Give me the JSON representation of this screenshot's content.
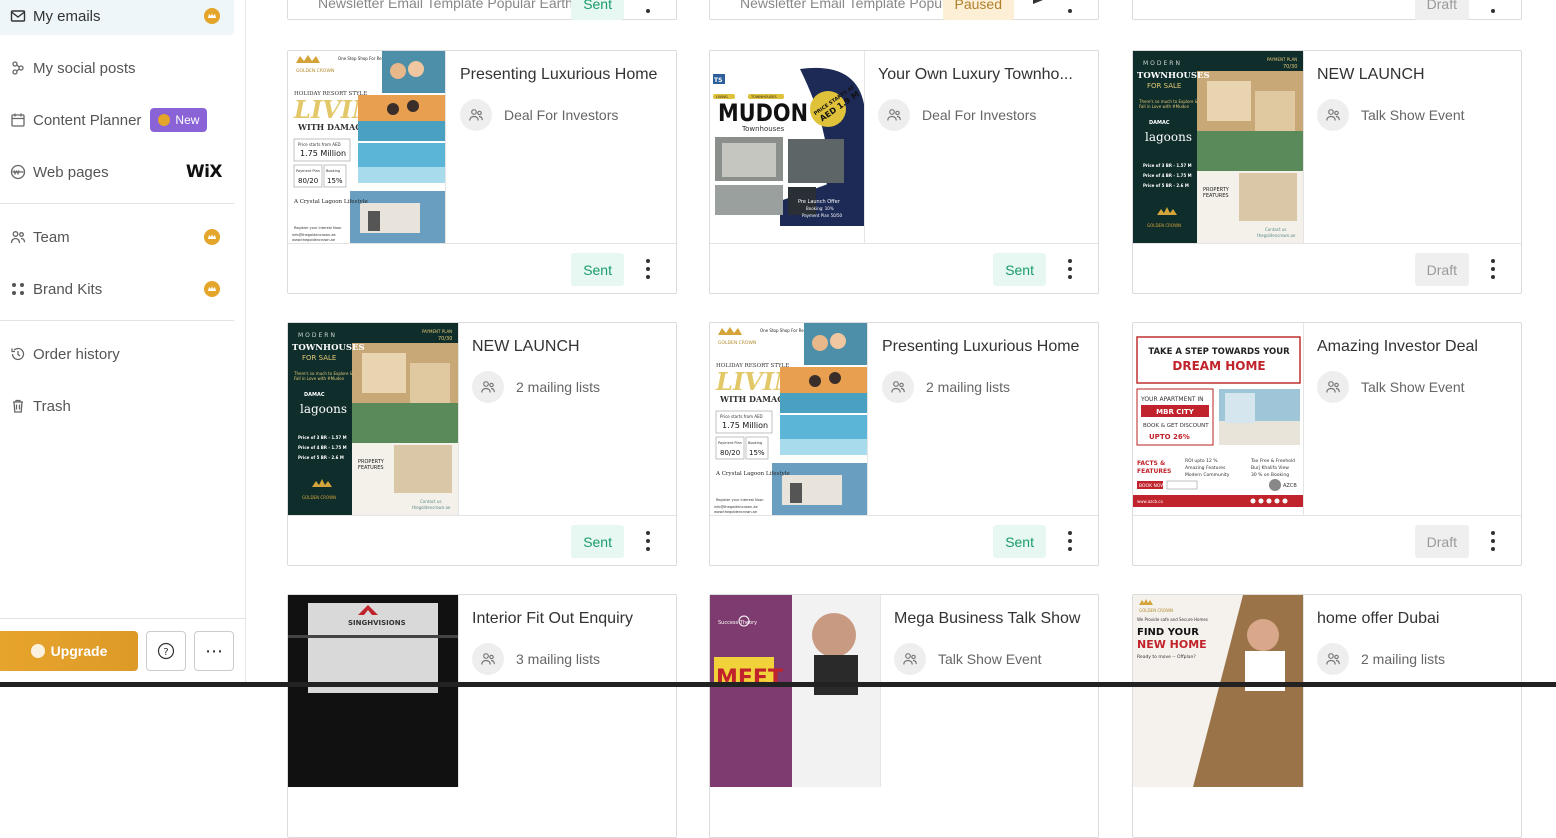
{
  "sidebar": {
    "items": [
      {
        "label": "My emails",
        "icon": "mail-icon",
        "crown": true,
        "active": true
      },
      {
        "label": "My social posts",
        "icon": "social-icon"
      },
      {
        "label": "Content Planner",
        "icon": "calendar-icon",
        "badge": "New"
      },
      {
        "label": "Web pages",
        "icon": "web-icon",
        "brand": "WiX"
      },
      {
        "label": "Team",
        "icon": "team-icon",
        "crown": true
      },
      {
        "label": "Brand Kits",
        "icon": "brand-kit-icon",
        "crown": true
      },
      {
        "label": "Order history",
        "icon": "history-icon"
      },
      {
        "label": "Trash",
        "icon": "trash-icon"
      }
    ],
    "upgrade_label": "Upgrade",
    "help_label": "?",
    "more_label": "⋯"
  },
  "top_partial": [
    {
      "text": "Newsletter Email Template Popular Earth",
      "status": "Sent"
    },
    {
      "text": "Newsletter Email Template Popular",
      "status": "Paused"
    },
    {
      "text": "",
      "status": "Draft"
    }
  ],
  "cards": [
    {
      "title": "Presenting Luxurious Home",
      "list": "Deal For Investors",
      "status": "Sent",
      "thumb": "golden",
      "thumb_text": {
        "brand": "GOLDEN CROWN",
        "tag": "One Stop Shop For Real Estate Solutions",
        "line1": "HOLIDAY RESORT STYLE",
        "line2": "LIVING",
        "line3": "WITH DAMAC",
        "price_lbl": "Price starts from AED",
        "price": "1.75 Million",
        "plan_lbl": "Payment Plan",
        "plan": "80/20",
        "booking_lbl": "Booking",
        "booking": "15%",
        "lagoon": "A Crystal Lagoon Lifestyle",
        "register": "Register your interest Now:",
        "email": "info@thegoldencrown.ae",
        "web": "www.thegoldencrown.ae"
      }
    },
    {
      "title": "Your Own Luxury  Townho...",
      "list": "Deal For Investors",
      "status": "Sent",
      "thumb": "mudon",
      "thumb_text": {
        "logo": "TS",
        "label1": "LIVING",
        "label2": "TOWNHOUSES",
        "name": "MUDON",
        "sub": "Townhouses",
        "badge": "PRICE STARTS AT AED 1.9 M",
        "offer": "Pre Launch Offer",
        "booking": "Booking: 10%",
        "plan": "Payment Plan 50/50"
      }
    },
    {
      "title": "NEW LAUNCH",
      "list": "Talk Show Event",
      "status": "Draft",
      "thumb": "townhouse",
      "thumb_text": {
        "line1": "MODERN",
        "line2": "TOWNHOUSES",
        "line3": "FOR SALE",
        "plan": "PAYMENT PLAN 70/30",
        "tag": "There's so much to Explore & Fall in Love with #Mudon",
        "brand": "DAMAC",
        "brand2": "lagoons",
        "prices": [
          "Price of 3 BR - 1.57 M",
          "Price of 4 BR - 1.75 M",
          "Price of 5 BR - 2.6 M"
        ],
        "feat": "PROPERTY FEATURES",
        "logo": "GOLDEN CROWN",
        "contact": "Contact us thegoldencrown.ae"
      }
    },
    {
      "title": "NEW LAUNCH",
      "list": "2 mailing lists",
      "status": "Sent",
      "thumb": "townhouse",
      "thumb_text": {
        "line1": "MODERN",
        "line2": "TOWNHOUSES",
        "line3": "FOR SALE",
        "plan": "PAYMENT PLAN 70/30",
        "tag": "There's so much to Explore & Fall in Love with #Mudon",
        "brand": "DAMAC",
        "brand2": "lagoons",
        "prices": [
          "Price of 3 BR - 1.57 M",
          "Price of 4 BR - 1.75 M",
          "Price of 5 BR - 2.6 M"
        ],
        "feat": "PROPERTY FEATURES",
        "logo": "GOLDEN CROWN",
        "contact": "Contact us thegoldencrown.ae"
      }
    },
    {
      "title": "Presenting Luxurious Home",
      "list": "2 mailing lists",
      "status": "Sent",
      "thumb": "golden",
      "thumb_text": {
        "brand": "GOLDEN CROWN",
        "tag": "One Stop Shop For Real Estate Solutions",
        "line1": "HOLIDAY RESORT STYLE",
        "line2": "LIVING",
        "line3": "WITH DAMAC",
        "price_lbl": "Price starts from AED",
        "price": "1.75 Million",
        "plan_lbl": "Payment Plan",
        "plan": "80/20",
        "booking_lbl": "Booking",
        "booking": "15%",
        "lagoon": "A Crystal Lagoon Lifestyle",
        "register": "Register your interest Now:",
        "email": "info@thegoldencrown.ae",
        "web": "www.thegoldencrown.ae"
      }
    },
    {
      "title": "Amazing Investor Deal",
      "list": "Talk Show Event",
      "status": "Draft",
      "thumb": "dream",
      "thumb_text": {
        "line1": "TAKE A STEP TOWARDS YOUR",
        "line2": "DREAM HOME",
        "apt": "YOUR APARTMENT IN",
        "city": "MBR CITY",
        "discount": "BOOK & GET DISCOUNT",
        "upto": "UPTO 26%",
        "facts": "FACTS & FEATURES",
        "f1": "ROI upto 12 %",
        "f2": "Tax Free & Freehold",
        "f3": "Amazing Features",
        "f4": "Burj Khalifa View",
        "f5": "Modern Community",
        "f6": "30 % on Booking",
        "book": "BOOK NOW",
        "brand": "AZCB"
      }
    },
    {
      "title": "Interior Fit Out Enquiry",
      "list": "3 mailing lists",
      "status": "",
      "thumb": "interior",
      "thumb_text": {
        "brand": "SINGHVISIONS"
      }
    },
    {
      "title": "Mega Business Talk Show",
      "list": "Talk Show Event",
      "status": "",
      "thumb": "mega",
      "thumb_text": {
        "brand": "Success Theory",
        "meet": "MEET"
      }
    },
    {
      "title": "home offer Dubai",
      "list": "2 mailing lists",
      "status": "",
      "thumb": "find",
      "thumb_text": {
        "brand": "GOLDEN CROWN",
        "tag": "We Provide safe and Secure Homes",
        "line1": "FIND YOUR",
        "line2": "NEW HOME",
        "line3": "Ready to move -- Offplan?"
      }
    }
  ],
  "colors": {
    "accent": "#8a64d6",
    "crown": "#e3a52a",
    "sent_bg": "#e7f7f2",
    "sent_fg": "#1a9c6b",
    "draft_bg": "#efefef",
    "paused_bg": "#fcefd6"
  }
}
